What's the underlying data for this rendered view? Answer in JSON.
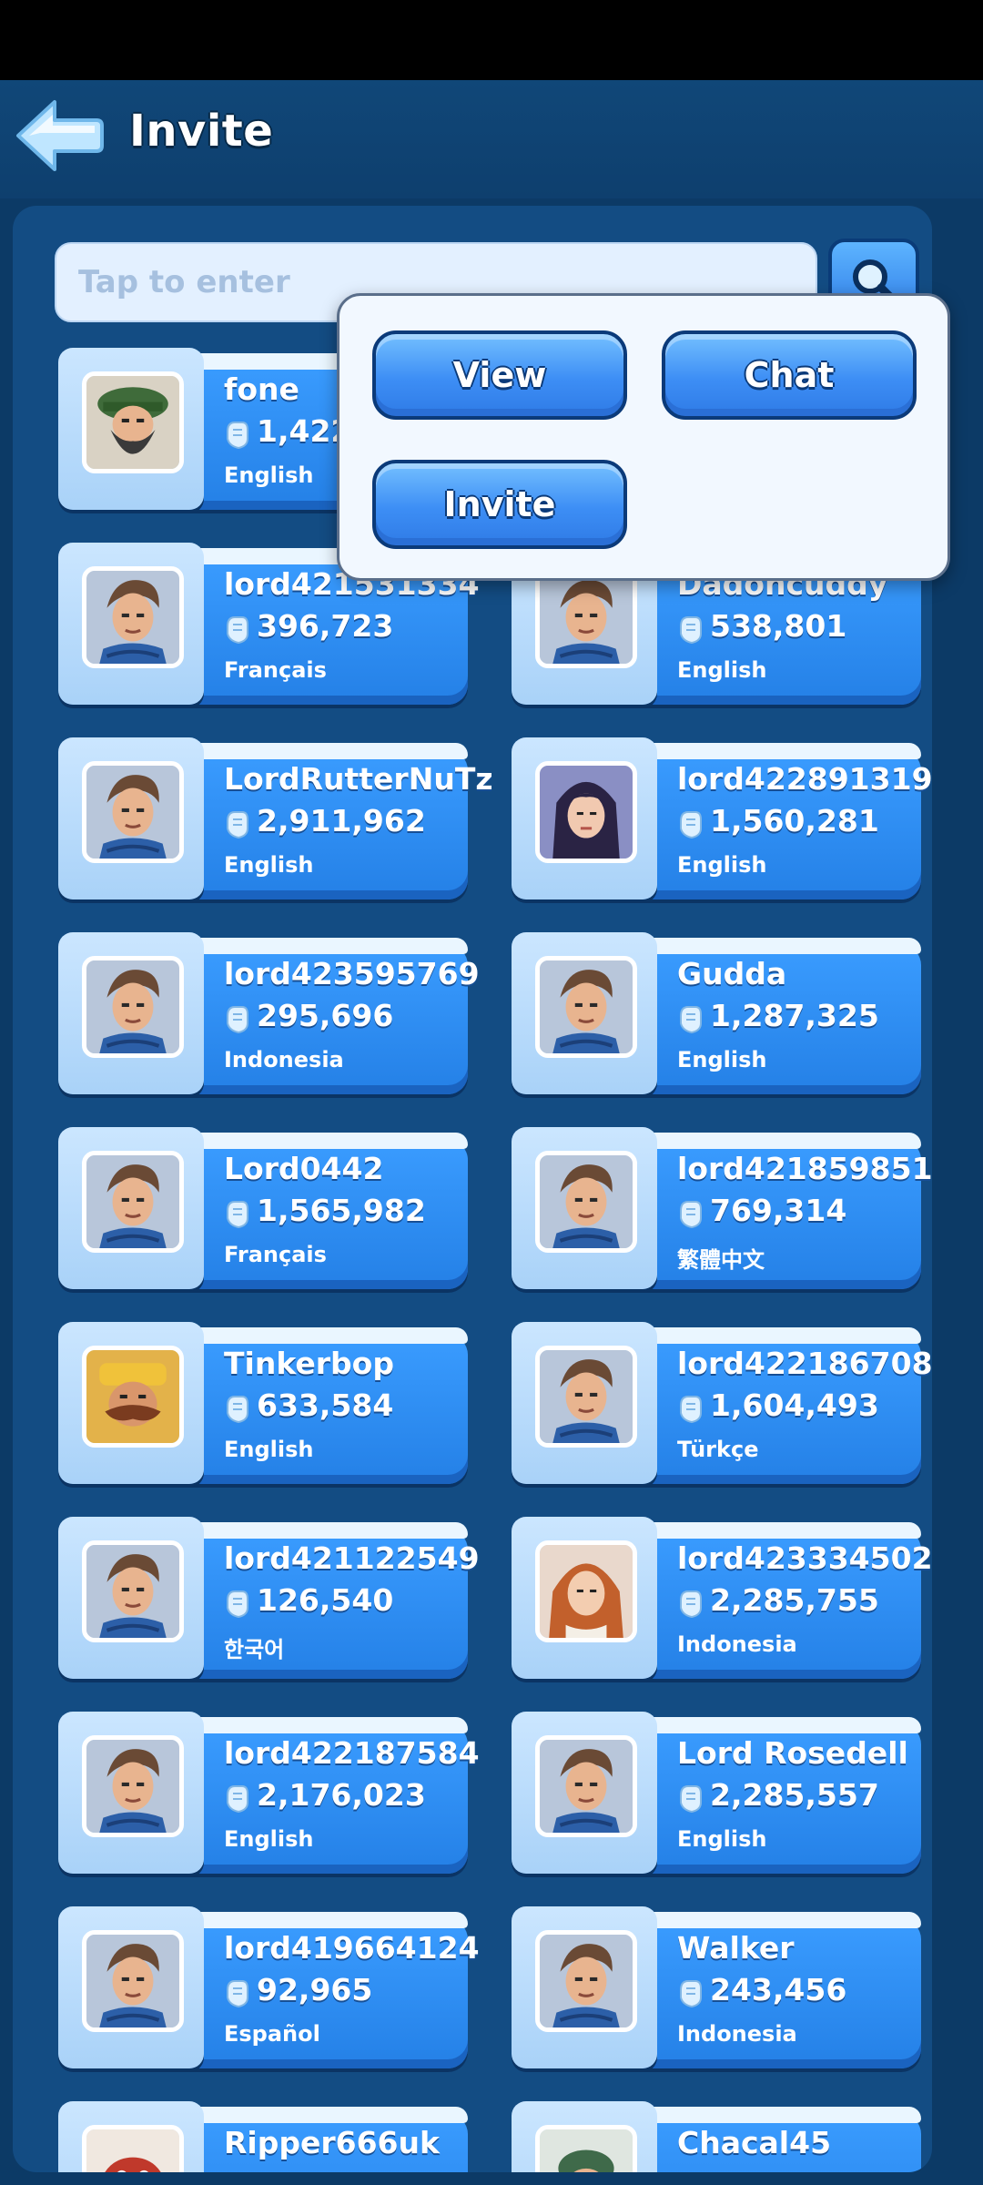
{
  "header": {
    "title": "Invite"
  },
  "search": {
    "placeholder": "Tap to enter"
  },
  "popup": {
    "view_label": "View",
    "chat_label": "Chat",
    "invite_label": "Invite"
  },
  "players": [
    {
      "name": "fone",
      "power": "1,422",
      "language": "English",
      "avatar": "bearded-hat"
    },
    {
      "name": "",
      "power": "",
      "language": "",
      "avatar": "default"
    },
    {
      "name": "lord421531334",
      "power": "396,723",
      "language": "Français",
      "avatar": "default"
    },
    {
      "name": "Dadoncuddy",
      "power": "538,801",
      "language": "English",
      "avatar": "default"
    },
    {
      "name": "LordRutterNuTz",
      "power": "2,911,962",
      "language": "English",
      "avatar": "default"
    },
    {
      "name": "lord422891319",
      "power": "1,560,281",
      "language": "English",
      "avatar": "dark-hair-woman"
    },
    {
      "name": "lord423595769",
      "power": "295,696",
      "language": "Indonesia",
      "avatar": "default"
    },
    {
      "name": "Gudda",
      "power": "1,287,325",
      "language": "English",
      "avatar": "default"
    },
    {
      "name": "Lord0442",
      "power": "1,565,982",
      "language": "Français",
      "avatar": "default"
    },
    {
      "name": "lord421859851",
      "power": "769,314",
      "language": "繁體中文",
      "avatar": "default"
    },
    {
      "name": "Tinkerbop",
      "power": "633,584",
      "language": "English",
      "avatar": "mustache-man"
    },
    {
      "name": "lord422186708",
      "power": "1,604,493",
      "language": "Türkçe",
      "avatar": "default"
    },
    {
      "name": "lord421122549",
      "power": "126,540",
      "language": "한국어",
      "avatar": "default"
    },
    {
      "name": "lord423334502",
      "power": "2,285,755",
      "language": "Indonesia",
      "avatar": "red-hair-woman"
    },
    {
      "name": "lord422187584",
      "power": "2,176,023",
      "language": "English",
      "avatar": "default"
    },
    {
      "name": "Lord Rosedell",
      "power": "2,285,557",
      "language": "English",
      "avatar": "default"
    },
    {
      "name": "lord419664124",
      "power": "92,965",
      "language": "Español",
      "avatar": "default"
    },
    {
      "name": "Walker",
      "power": "243,456",
      "language": "Indonesia",
      "avatar": "default"
    },
    {
      "name": "Ripper666uk",
      "power": "",
      "language": "",
      "avatar": "red-creature"
    },
    {
      "name": "Chacal45",
      "power": "",
      "language": "",
      "avatar": "green-helmet"
    }
  ],
  "colors": {
    "background": "#0c3a66",
    "panel": "#134c83",
    "card": "#2f8cf2",
    "popup": "#f2f8ff",
    "button": "#3d8ef5"
  }
}
